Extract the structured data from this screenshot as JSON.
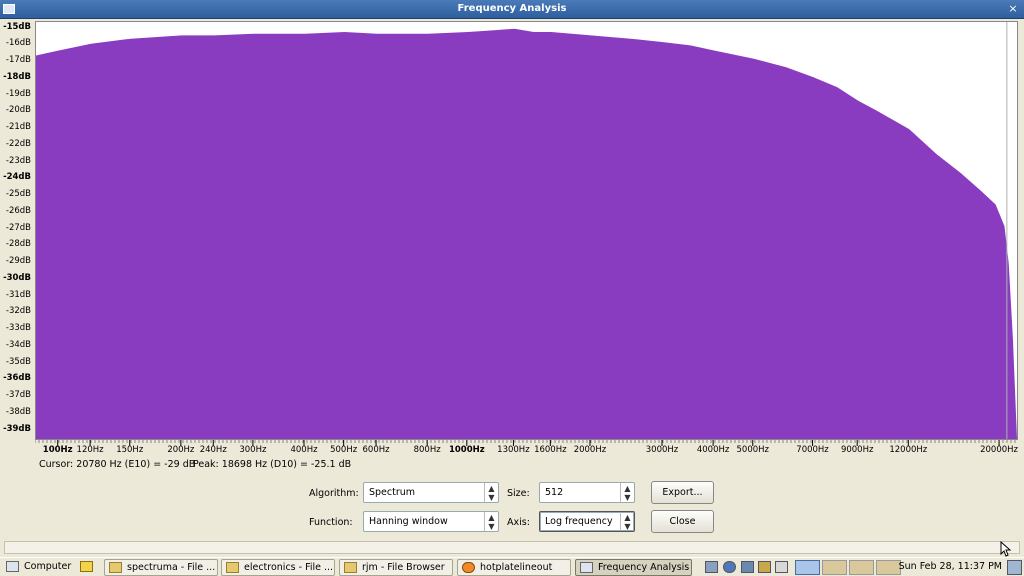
{
  "window": {
    "title": "Frequency Analysis",
    "close_glyph": "×"
  },
  "chart_data": {
    "type": "area",
    "title": "",
    "xlabel": "",
    "ylabel": "",
    "x_scale": "log",
    "xlim": [
      88,
      22000
    ],
    "ylim": [
      -39.5,
      -14.6
    ],
    "grid": false,
    "color": "#8a3cc0",
    "cursor_line_hz": 20780,
    "y_ticks": [
      {
        "label": "-15dB",
        "value": -15,
        "bold": true
      },
      {
        "label": "-16dB",
        "value": -16,
        "bold": false
      },
      {
        "label": "-17dB",
        "value": -17,
        "bold": false
      },
      {
        "label": "-18dB",
        "value": -18,
        "bold": true
      },
      {
        "label": "-19dB",
        "value": -19,
        "bold": false
      },
      {
        "label": "-20dB",
        "value": -20,
        "bold": false
      },
      {
        "label": "-21dB",
        "value": -21,
        "bold": false
      },
      {
        "label": "-22dB",
        "value": -22,
        "bold": false
      },
      {
        "label": "-23dB",
        "value": -23,
        "bold": false
      },
      {
        "label": "-24dB",
        "value": -24,
        "bold": true
      },
      {
        "label": "-25dB",
        "value": -25,
        "bold": false
      },
      {
        "label": "-26dB",
        "value": -26,
        "bold": false
      },
      {
        "label": "-27dB",
        "value": -27,
        "bold": false
      },
      {
        "label": "-28dB",
        "value": -28,
        "bold": false
      },
      {
        "label": "-29dB",
        "value": -29,
        "bold": false
      },
      {
        "label": "-30dB",
        "value": -30,
        "bold": true
      },
      {
        "label": "-31dB",
        "value": -31,
        "bold": false
      },
      {
        "label": "-32dB",
        "value": -32,
        "bold": false
      },
      {
        "label": "-33dB",
        "value": -33,
        "bold": false
      },
      {
        "label": "-34dB",
        "value": -34,
        "bold": false
      },
      {
        "label": "-35dB",
        "value": -35,
        "bold": false
      },
      {
        "label": "-36dB",
        "value": -36,
        "bold": true
      },
      {
        "label": "-37dB",
        "value": -37,
        "bold": false
      },
      {
        "label": "-38dB",
        "value": -38,
        "bold": false
      },
      {
        "label": "-39dB",
        "value": -39,
        "bold": true
      }
    ],
    "x_ticks": [
      {
        "label": "100Hz",
        "value": 100,
        "bold": true
      },
      {
        "label": "120Hz",
        "value": 120,
        "bold": false
      },
      {
        "label": "150Hz",
        "value": 150,
        "bold": false
      },
      {
        "label": "200Hz",
        "value": 200,
        "bold": false
      },
      {
        "label": "240Hz",
        "value": 240,
        "bold": false
      },
      {
        "label": "300Hz",
        "value": 300,
        "bold": false
      },
      {
        "label": "400Hz",
        "value": 400,
        "bold": false
      },
      {
        "label": "500Hz",
        "value": 500,
        "bold": false
      },
      {
        "label": "600Hz",
        "value": 600,
        "bold": false
      },
      {
        "label": "800Hz",
        "value": 800,
        "bold": false
      },
      {
        "label": "1000Hz",
        "value": 1000,
        "bold": true
      },
      {
        "label": "1300Hz",
        "value": 1300,
        "bold": false
      },
      {
        "label": "1600Hz",
        "value": 1600,
        "bold": false
      },
      {
        "label": "2000Hz",
        "value": 2000,
        "bold": false
      },
      {
        "label": "3000Hz",
        "value": 3000,
        "bold": false
      },
      {
        "label": "4000Hz",
        "value": 4000,
        "bold": false
      },
      {
        "label": "5000Hz",
        "value": 5000,
        "bold": false
      },
      {
        "label": "7000Hz",
        "value": 7000,
        "bold": false
      },
      {
        "label": "9000Hz",
        "value": 9000,
        "bold": false
      },
      {
        "label": "12000Hz",
        "value": 12000,
        "bold": false
      },
      {
        "label": "20000Hz",
        "value": 20000,
        "bold": false
      }
    ],
    "series": [
      {
        "x": [
          88,
          100,
          120,
          150,
          200,
          240,
          300,
          400,
          500,
          600,
          800,
          1000,
          1150,
          1300,
          1450,
          1600,
          2000,
          2500,
          3000,
          3500,
          4000,
          5000,
          6000,
          7000,
          8000,
          9000,
          10000,
          12000,
          14000,
          16000,
          18000,
          19500,
          20500,
          21000,
          21500,
          22000
        ],
        "y": [
          -16.6,
          -16.3,
          -15.9,
          -15.6,
          -15.4,
          -15.4,
          -15.3,
          -15.3,
          -15.2,
          -15.3,
          -15.3,
          -15.2,
          -15.1,
          -15.0,
          -15.2,
          -15.2,
          -15.4,
          -15.6,
          -15.8,
          -16.0,
          -16.3,
          -16.8,
          -17.3,
          -17.9,
          -18.5,
          -19.3,
          -19.9,
          -21.0,
          -22.5,
          -23.6,
          -24.7,
          -25.5,
          -26.8,
          -29.0,
          -33.5,
          -39.5
        ]
      }
    ]
  },
  "readouts": {
    "cursor": "Cursor: 20780 Hz (E10) = -29 dB",
    "peak": "Peak: 18698 Hz (D10) = -25.1 dB"
  },
  "controls": {
    "algorithm_label": "Algorithm:",
    "algorithm_value": "Spectrum",
    "function_label": "Function:",
    "function_value": "Hanning window",
    "size_label": "Size:",
    "size_value": "512",
    "axis_label": "Axis:",
    "axis_value": "Log frequency",
    "export_label": "Export...",
    "close_label": "Close"
  },
  "taskbar": {
    "computer": "Computer",
    "items": [
      "spectruma - File ...",
      "electronics - File ...",
      "rjm - File Browser",
      "hotplatelineout",
      "Frequency Analysis"
    ],
    "clock": "Sun Feb 28, 11:37 PM"
  }
}
